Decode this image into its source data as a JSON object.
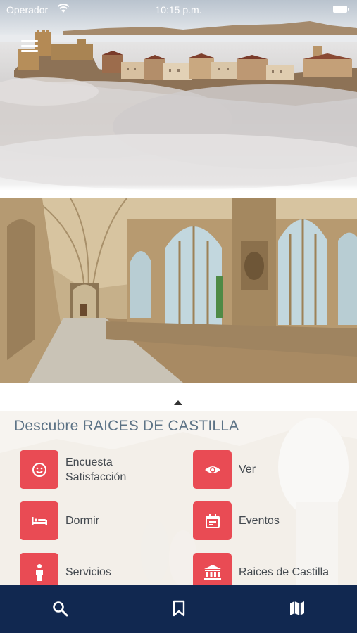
{
  "status_bar": {
    "carrier": "Operador",
    "time": "10:15 p.m.",
    "wifi_icon": "wifi-icon",
    "battery_icon": "battery-icon"
  },
  "header": {
    "menu_icon": "hamburger-menu-icon"
  },
  "panel": {
    "title": "Descubre RAICES DE CASTILLA",
    "items": [
      {
        "label": "Encuesta Satisfacción",
        "icon": "smiley-icon"
      },
      {
        "label": "Ver",
        "icon": "eye-icon"
      },
      {
        "label": "Dormir",
        "icon": "bed-icon"
      },
      {
        "label": "Eventos",
        "icon": "calendar-icon"
      },
      {
        "label": "Servicios",
        "icon": "person-icon"
      },
      {
        "label": "Raices de Castilla",
        "icon": "museum-icon"
      }
    ]
  },
  "tab_bar": {
    "tabs": [
      {
        "icon": "search-icon"
      },
      {
        "icon": "bookmark-icon"
      },
      {
        "icon": "map-icon"
      }
    ]
  },
  "colors": {
    "accent": "#e94b54",
    "tab_bar": "#112850",
    "title": "#5d7386"
  }
}
